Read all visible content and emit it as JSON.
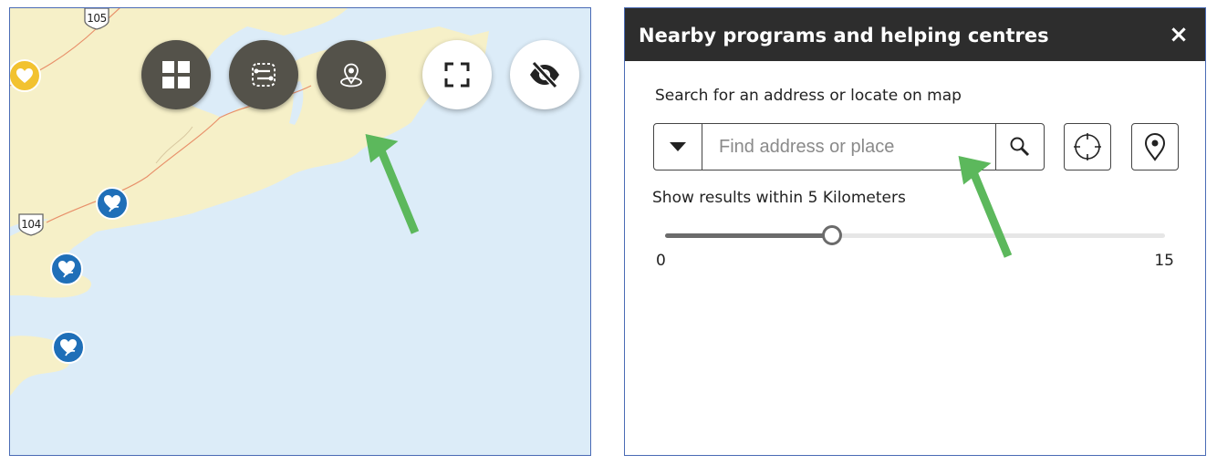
{
  "map": {
    "highway_shields": [
      {
        "name": "highway-shield-105",
        "label": "105"
      },
      {
        "name": "highway-shield-104",
        "label": "104"
      }
    ],
    "markers": {
      "yellow_marker_icon": "heart-location-marker-icon",
      "blue_marker_icon": "heart-leaf-location-marker-icon"
    },
    "toolbar": {
      "buttons": [
        {
          "name": "layer-list-button",
          "icon": "grid-icon",
          "style": "dark"
        },
        {
          "name": "route-button",
          "icon": "route-icon",
          "style": "dark"
        },
        {
          "name": "nearby-button",
          "icon": "location-pin-icon",
          "style": "dark"
        },
        {
          "name": "fullscreen-button",
          "icon": "fullscreen-icon",
          "style": "light"
        },
        {
          "name": "hide-button",
          "icon": "eye-slash-icon",
          "style": "light"
        }
      ]
    },
    "colors": {
      "water": "#dcecf8",
      "land": "#f6f0c8",
      "button_dark": "#54524a",
      "annotation_arrow": "#5cb85c"
    }
  },
  "panel": {
    "title": "Nearby programs and helping centres",
    "close_label": "×",
    "search_heading": "Search for an address or locate on map",
    "search": {
      "placeholder": "Find address or place",
      "value": ""
    },
    "buttons": {
      "dropdown_icon": "caret-down-icon",
      "search_icon": "search-icon",
      "locate_icon": "crosshair-icon",
      "select_on_map_icon": "map-pin-icon"
    },
    "radius_label": "Show results within 5 Kilometers",
    "slider": {
      "min_label": "0",
      "max_label": "15",
      "min": 0,
      "max": 15,
      "value": 5
    },
    "colors": {
      "header_bg": "#2d2d2d",
      "border": "#4a6bb5"
    }
  }
}
